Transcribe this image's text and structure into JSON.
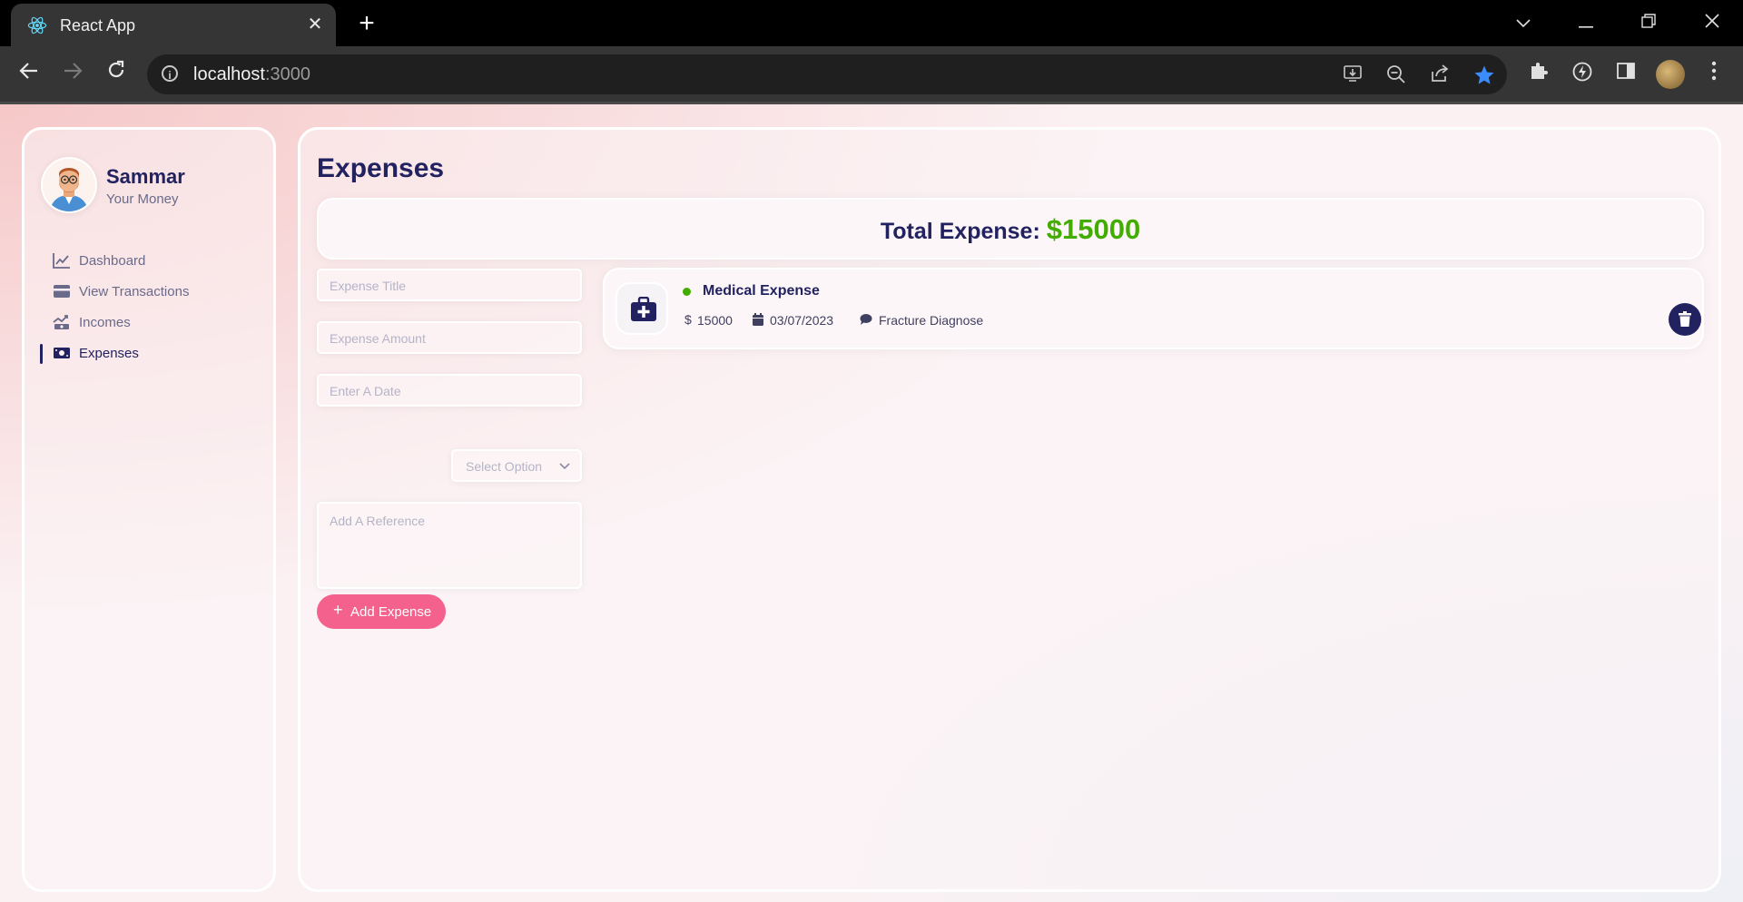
{
  "browser": {
    "tab_title": "React App",
    "url_host": "localhost",
    "url_port": ":3000"
  },
  "sidebar": {
    "user_name": "Sammar",
    "user_subtitle": "Your Money",
    "items": [
      {
        "label": "Dashboard",
        "icon": "chart-line-icon",
        "active": false
      },
      {
        "label": "View Transactions",
        "icon": "credit-card-icon",
        "active": false
      },
      {
        "label": "Incomes",
        "icon": "money-trend-icon",
        "active": false
      },
      {
        "label": "Expenses",
        "icon": "money-bill-icon",
        "active": true
      }
    ]
  },
  "main": {
    "title": "Expenses",
    "total_label": "Total Expense:",
    "total_amount": "$15000"
  },
  "form": {
    "title_placeholder": "Expense Title",
    "amount_placeholder": "Expense Amount",
    "date_placeholder": "Enter A Date",
    "select_placeholder": "Select Option",
    "reference_placeholder": "Add A Reference",
    "submit_label": "Add Expense"
  },
  "expenses": [
    {
      "title": "Medical Expense",
      "amount": "15000",
      "date": "03/07/2023",
      "description": "Fracture Diagnose",
      "icon": "medical-kit-icon",
      "status_color": "#42ad00"
    }
  ],
  "colors": {
    "accent_navy": "#222260",
    "expense_green": "#42ad00",
    "button_pink": "#f5618d"
  }
}
